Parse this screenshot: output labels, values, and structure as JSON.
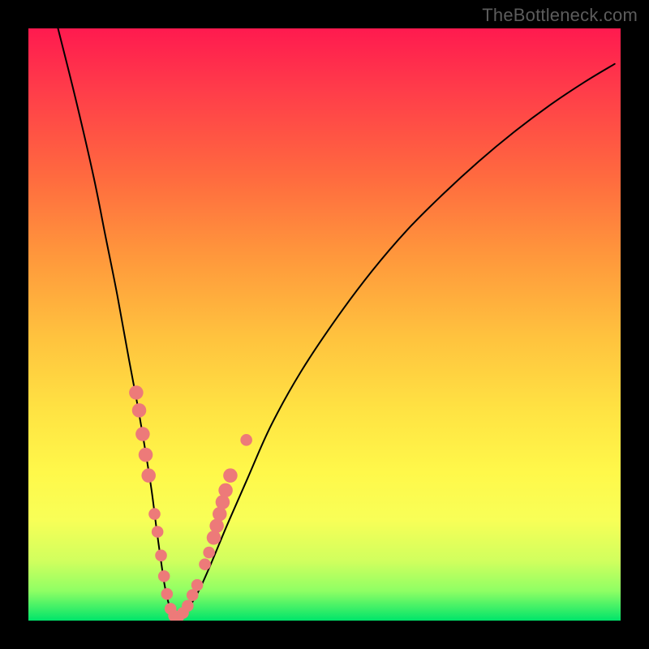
{
  "watermark": "TheBottleneck.com",
  "colors": {
    "curve": "#000000",
    "dot_fill": "#ed7a79",
    "gradient_top": "#ff1a4f",
    "gradient_bottom": "#00e46a",
    "background": "#000000"
  },
  "chart_data": {
    "type": "line",
    "title": "",
    "xlabel": "",
    "ylabel": "",
    "xlim": [
      0,
      100
    ],
    "ylim": [
      0,
      100
    ],
    "curve": {
      "name": "bottleneck-curve",
      "x": [
        5,
        8,
        11,
        13,
        15,
        17,
        18.5,
        19.7,
        20.8,
        21.7,
        22.4,
        23,
        23.6,
        24.2,
        25,
        26,
        27.3,
        29,
        31,
        33.5,
        37,
        41,
        46,
        52,
        58,
        64,
        70,
        76,
        82,
        88,
        94,
        99
      ],
      "y": [
        100,
        88,
        75,
        65,
        55,
        44,
        36,
        29,
        22,
        15,
        10,
        6,
        3.2,
        1.5,
        0.5,
        0.9,
        2.5,
        5.5,
        10,
        16,
        24,
        33,
        42,
        51,
        59,
        66,
        72,
        77.5,
        82.5,
        87,
        91,
        94
      ]
    },
    "scatter": {
      "name": "highlight-points",
      "points": [
        {
          "x": 18.2,
          "y": 38.5,
          "r": 1.2
        },
        {
          "x": 18.7,
          "y": 35.5,
          "r": 1.2
        },
        {
          "x": 19.3,
          "y": 31.5,
          "r": 1.2
        },
        {
          "x": 19.8,
          "y": 28.0,
          "r": 1.2
        },
        {
          "x": 20.3,
          "y": 24.5,
          "r": 1.2
        },
        {
          "x": 21.3,
          "y": 18.0,
          "r": 1.0
        },
        {
          "x": 21.8,
          "y": 15.0,
          "r": 1.0
        },
        {
          "x": 22.4,
          "y": 11.0,
          "r": 1.0
        },
        {
          "x": 22.9,
          "y": 7.5,
          "r": 1.0
        },
        {
          "x": 23.4,
          "y": 4.5,
          "r": 1.0
        },
        {
          "x": 24.0,
          "y": 2.0,
          "r": 1.0
        },
        {
          "x": 24.6,
          "y": 0.8,
          "r": 1.0
        },
        {
          "x": 25.3,
          "y": 0.6,
          "r": 1.0
        },
        {
          "x": 26.1,
          "y": 1.3,
          "r": 1.0
        },
        {
          "x": 26.9,
          "y": 2.5,
          "r": 1.0
        },
        {
          "x": 27.7,
          "y": 4.3,
          "r": 1.0
        },
        {
          "x": 28.5,
          "y": 6.0,
          "r": 1.0
        },
        {
          "x": 29.8,
          "y": 9.5,
          "r": 1.0
        },
        {
          "x": 30.5,
          "y": 11.5,
          "r": 1.0
        },
        {
          "x": 31.3,
          "y": 14.0,
          "r": 1.2
        },
        {
          "x": 31.8,
          "y": 16.0,
          "r": 1.2
        },
        {
          "x": 32.3,
          "y": 18.0,
          "r": 1.2
        },
        {
          "x": 32.8,
          "y": 20.0,
          "r": 1.2
        },
        {
          "x": 33.3,
          "y": 22.0,
          "r": 1.2
        },
        {
          "x": 34.1,
          "y": 24.5,
          "r": 1.2
        },
        {
          "x": 36.8,
          "y": 30.5,
          "r": 1.0
        }
      ]
    }
  }
}
